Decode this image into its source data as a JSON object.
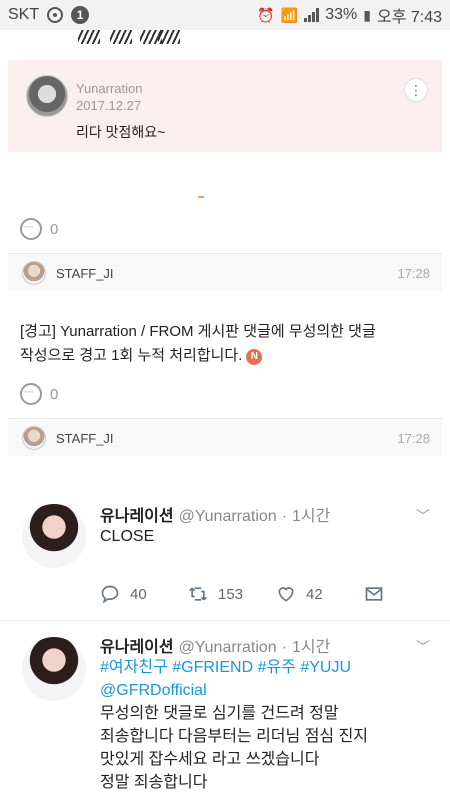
{
  "status_bar": {
    "carrier": "SKT",
    "notification_count": "1",
    "battery": "33%",
    "time": "오후 7:43"
  },
  "comment_card": {
    "author": "Yunarration",
    "date": "2017.12.27",
    "text": "리다 맛점해요~"
  },
  "comment_counts": [
    "0",
    "0"
  ],
  "staff_rows": [
    {
      "name": "STAFF_JI",
      "time": "17:28"
    },
    {
      "name": "STAFF_JI",
      "time": "17:28"
    }
  ],
  "notice": {
    "line1": "[경고] Yunarration / FROM 게시판 댓글에 무성의한 댓글",
    "line2": "작성으로 경고 1회 누적 처리합니다.",
    "badge": "N"
  },
  "tweets": [
    {
      "name": "유나레이션",
      "handle": "@Yunarration",
      "time": "1시간",
      "text": "CLOSE",
      "replies": "40",
      "retweets": "153",
      "likes": "42"
    },
    {
      "name": "유나레이션",
      "handle": "@Yunarration",
      "time": "1시간",
      "hashtags": "#여자친구 #GFRIEND #유주 #YUJU",
      "mention": "@GFRDofficial",
      "lines": [
        "무성의한 댓글로 심기를 건드려 정말",
        "죄송합니다 다음부터는 리더님 점심 진지",
        "맛있게 잡수세요 라고 쓰겠습니다",
        "정말 죄송합니다"
      ]
    }
  ]
}
